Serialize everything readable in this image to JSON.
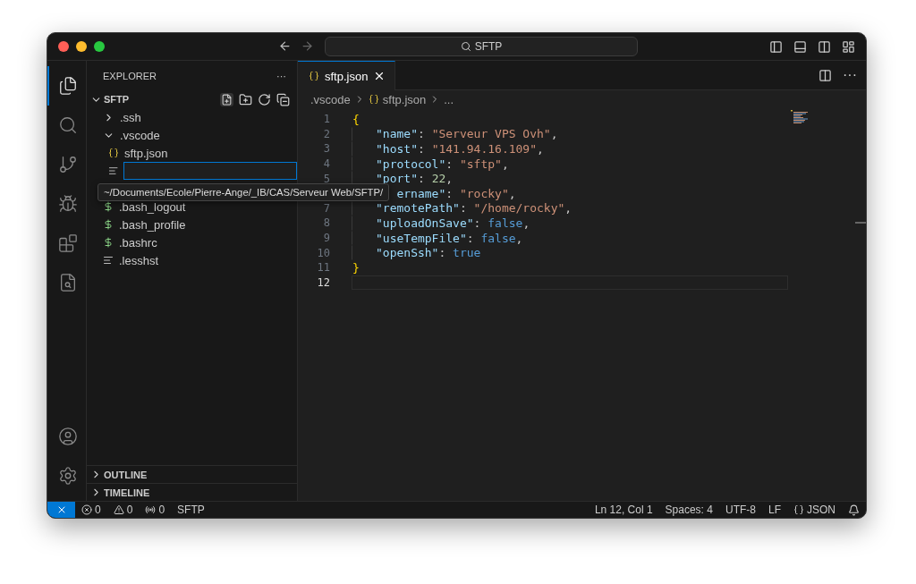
{
  "title_bar": {
    "search": "SFTP"
  },
  "activity_bar": [
    {
      "kind": "explorer",
      "selected": true
    },
    {
      "kind": "search",
      "selected": false
    },
    {
      "kind": "source-control",
      "selected": false
    },
    {
      "kind": "run",
      "selected": false
    },
    {
      "kind": "extensions",
      "selected": false
    },
    {
      "kind": "remote",
      "selected": false
    }
  ],
  "activity_bar_bottom": [
    {
      "kind": "account"
    },
    {
      "kind": "settings"
    }
  ],
  "sidebar": {
    "title": "EXPLORER",
    "more": "···",
    "section": {
      "title": "SFTP",
      "expanded": true,
      "items": [
        {
          "kind": "folder",
          "label": ".ssh",
          "expanded": false
        },
        {
          "kind": "folder",
          "label": ".vscode",
          "expanded": true,
          "children": [
            {
              "kind": "json",
              "label": "sftp.json"
            }
          ]
        },
        {
          "kind": "input",
          "focused": true
        },
        {
          "kind": "shell",
          "label": ".bash_logout"
        },
        {
          "kind": "shell",
          "label": ".bash_profile"
        },
        {
          "kind": "shell",
          "label": ".bashrc"
        },
        {
          "kind": "text",
          "label": ".lesshst"
        }
      ]
    },
    "tooltip": "~/Documents/Ecole/Pierre-Ange/_IB/CAS/Serveur Web/SFTP/",
    "bottom_sections": [
      {
        "title": "OUTLINE",
        "expanded": false
      },
      {
        "title": "TIMELINE",
        "expanded": false
      }
    ]
  },
  "editor": {
    "tabs": [
      {
        "label": "sftp.json",
        "selected": true
      }
    ],
    "more": "···",
    "breadcrumb": [
      {
        "kind": "folder",
        "text": ".vscode"
      },
      {
        "kind": "json",
        "text": "sftp.json"
      },
      {
        "kind": "more",
        "text": "..."
      }
    ],
    "lines": [
      {
        "number": "1",
        "kind": "brace",
        "current": false,
        "tokens": [
          {
            "kind": "brace",
            "text": "{"
          }
        ]
      },
      {
        "number": "2",
        "kind": "member",
        "current": false,
        "tokens": [
          {
            "kind": "key",
            "text": "\"name\""
          },
          {
            "kind": "punct",
            "text": ": "
          },
          {
            "kind": "string",
            "text": "\"Serveur VPS Ovh\""
          },
          {
            "kind": "punct",
            "text": ","
          }
        ]
      },
      {
        "number": "3",
        "kind": "member",
        "current": false,
        "tokens": [
          {
            "kind": "key",
            "text": "\"host\""
          },
          {
            "kind": "punct",
            "text": ": "
          },
          {
            "kind": "string",
            "text": "\"141.94.16.109\""
          },
          {
            "kind": "punct",
            "text": ","
          }
        ]
      },
      {
        "number": "4",
        "kind": "member",
        "current": false,
        "tokens": [
          {
            "kind": "key",
            "text": "\"protocol\""
          },
          {
            "kind": "punct",
            "text": ": "
          },
          {
            "kind": "string",
            "text": "\"sftp\""
          },
          {
            "kind": "punct",
            "text": ","
          }
        ]
      },
      {
        "number": "5",
        "kind": "member",
        "current": false,
        "tokens": [
          {
            "kind": "key",
            "text": "\"port\""
          },
          {
            "kind": "punct",
            "text": ": "
          },
          {
            "kind": "number",
            "text": "22"
          },
          {
            "kind": "punct",
            "text": ","
          }
        ]
      },
      {
        "kind": "covered",
        "current": false,
        "tokens": [
          {
            "kind": "key",
            "text": "ername\""
          },
          {
            "kind": "punct",
            "text": ": "
          },
          {
            "kind": "string",
            "text": "\"rocky\""
          },
          {
            "kind": "punct",
            "text": ","
          }
        ]
      },
      {
        "number": "7",
        "kind": "member",
        "current": false,
        "tokens": [
          {
            "kind": "key",
            "text": "\"remotePath\""
          },
          {
            "kind": "punct",
            "text": ": "
          },
          {
            "kind": "string",
            "text": "\"/home/rocky\""
          },
          {
            "kind": "punct",
            "text": ","
          }
        ]
      },
      {
        "number": "8",
        "kind": "member",
        "current": false,
        "tokens": [
          {
            "kind": "key",
            "text": "\"uploadOnSave\""
          },
          {
            "kind": "punct",
            "text": ": "
          },
          {
            "kind": "bool",
            "text": "false"
          },
          {
            "kind": "punct",
            "text": ","
          }
        ]
      },
      {
        "number": "9",
        "kind": "member",
        "current": false,
        "tokens": [
          {
            "kind": "key",
            "text": "\"useTempFile\""
          },
          {
            "kind": "punct",
            "text": ": "
          },
          {
            "kind": "bool",
            "text": "false"
          },
          {
            "kind": "punct",
            "text": ","
          }
        ]
      },
      {
        "number": "10",
        "kind": "member",
        "current": false,
        "tokens": [
          {
            "kind": "key",
            "text": "\"openSsh\""
          },
          {
            "kind": "punct",
            "text": ": "
          },
          {
            "kind": "bool",
            "text": "true"
          }
        ]
      },
      {
        "number": "11",
        "kind": "brace",
        "current": false,
        "tokens": [
          {
            "kind": "brace",
            "text": "}"
          }
        ]
      },
      {
        "number": "12",
        "kind": "brace",
        "current": true
      }
    ]
  },
  "status_bar": {
    "left": [
      {
        "kind": "errors",
        "text": "0"
      },
      {
        "kind": "warnings",
        "text": "0"
      },
      {
        "kind": "ports",
        "text": "0"
      },
      {
        "kind": "plain",
        "text": "SFTP"
      }
    ],
    "right": [
      {
        "kind": "plain",
        "text": "Ln 12, Col 1"
      },
      {
        "kind": "plain",
        "text": "Spaces: 4"
      },
      {
        "kind": "plain",
        "text": "UTF-8"
      },
      {
        "kind": "plain",
        "text": "LF"
      },
      {
        "kind": "language",
        "text": "JSON"
      },
      {
        "kind": "bell"
      }
    ]
  }
}
